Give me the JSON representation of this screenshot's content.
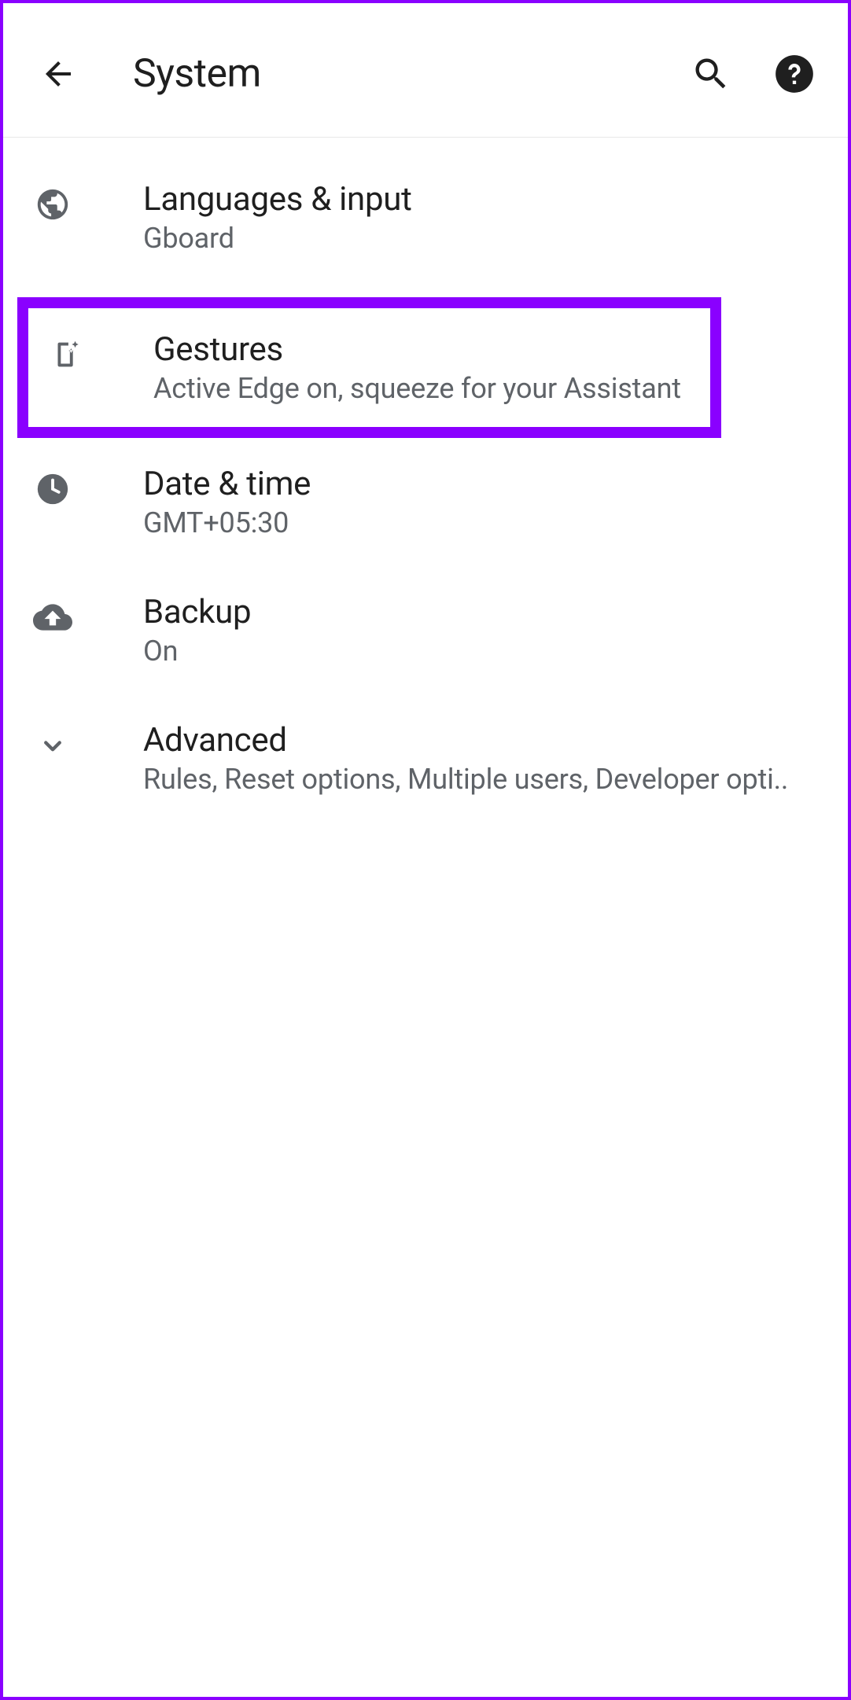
{
  "header": {
    "title": "System"
  },
  "settings": [
    {
      "title": "Languages & input",
      "subtitle": "Gboard"
    },
    {
      "title": "Gestures",
      "subtitle": "Active Edge on, squeeze for your Assistant"
    },
    {
      "title": "Date & time",
      "subtitle": "GMT+05:30"
    },
    {
      "title": "Backup",
      "subtitle": "On"
    },
    {
      "title": "Advanced",
      "subtitle": "Rules, Reset options, Multiple users, Developer opti.."
    }
  ]
}
